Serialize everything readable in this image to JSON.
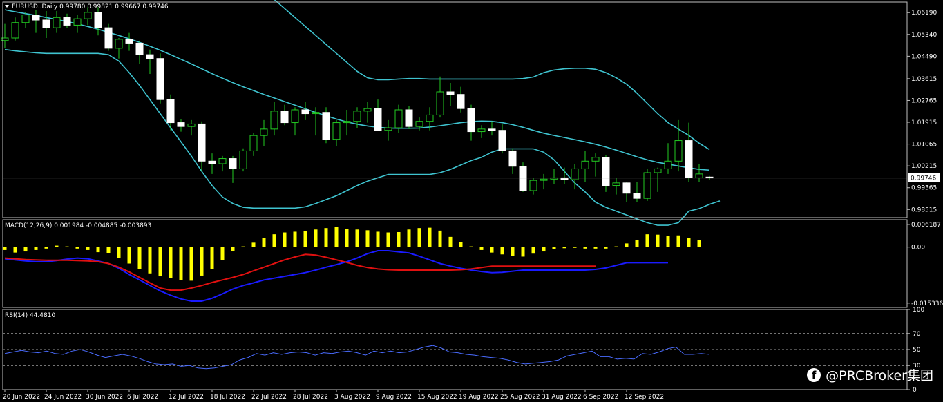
{
  "chart_data": [
    {
      "type": "candlestick",
      "title": "EURUSD..Daily  0.99780 0.99821 0.99667 0.99746",
      "symbol": "EURUSD..Daily",
      "ohlc_header": "0.99780 0.99821 0.99667 0.99746",
      "last_price": 0.99746,
      "last_price_label": "0.99746",
      "ylim": [
        0.982,
        1.066
      ],
      "yticks": [
        "1.06190",
        "1.05340",
        "1.04490",
        "1.03615",
        "1.02765",
        "1.01915",
        "1.01065",
        "1.00215",
        "0.99365",
        "0.98515"
      ],
      "yticks_values": [
        1.0619,
        1.0534,
        1.0449,
        1.03615,
        1.02765,
        1.01915,
        1.01065,
        1.00215,
        0.99365,
        0.98515
      ],
      "candles": [
        [
          1.051,
          1.0575,
          1.048,
          1.052
        ],
        [
          1.052,
          1.06,
          1.051,
          1.058
        ],
        [
          1.058,
          1.062,
          1.056,
          1.061
        ],
        [
          1.061,
          1.063,
          1.054,
          1.059
        ],
        [
          1.059,
          1.0625,
          1.052,
          1.056
        ],
        [
          1.056,
          1.0625,
          1.054,
          1.06
        ],
        [
          1.06,
          1.0615,
          1.056,
          1.057
        ],
        [
          1.057,
          1.061,
          1.054,
          1.0595
        ],
        [
          1.0595,
          1.064,
          1.057,
          1.062
        ],
        [
          1.062,
          1.064,
          1.053,
          1.056
        ],
        [
          1.056,
          1.0575,
          1.047,
          1.048
        ],
        [
          1.048,
          1.052,
          1.044,
          1.0515
        ],
        [
          1.0515,
          1.054,
          1.047,
          1.05
        ],
        [
          1.05,
          1.051,
          1.042,
          1.0455
        ],
        [
          1.0455,
          1.0475,
          1.038,
          1.044
        ],
        [
          1.044,
          1.046,
          1.0265,
          1.028
        ],
        [
          1.028,
          1.03,
          1.016,
          1.019
        ],
        [
          1.019,
          1.0205,
          1.0155,
          1.0175
        ],
        [
          1.0175,
          1.02,
          1.014,
          1.0185
        ],
        [
          1.0185,
          1.0195,
          1.0,
          1.004
        ],
        [
          1.004,
          1.007,
          0.999,
          1.003
        ],
        [
          1.003,
          1.006,
          1.0,
          1.005
        ],
        [
          1.005,
          1.006,
          0.9955,
          1.001
        ],
        [
          1.001,
          1.009,
          1.0,
          1.008
        ],
        [
          1.008,
          1.015,
          1.006,
          1.014
        ],
        [
          1.014,
          1.02,
          1.01,
          1.0165
        ],
        [
          1.0165,
          1.027,
          1.014,
          1.0235
        ],
        [
          1.0235,
          1.026,
          1.018,
          1.019
        ],
        [
          1.019,
          1.025,
          1.014,
          1.024
        ],
        [
          1.024,
          1.027,
          1.02,
          1.0225
        ],
        [
          1.0225,
          1.025,
          1.014,
          1.023
        ],
        [
          1.023,
          1.025,
          1.011,
          1.0125
        ],
        [
          1.0125,
          1.02,
          1.01,
          1.019
        ],
        [
          1.019,
          1.024,
          1.014,
          1.0195
        ],
        [
          1.0195,
          1.025,
          1.017,
          1.0235
        ],
        [
          1.0235,
          1.027,
          1.019,
          1.0245
        ],
        [
          1.0245,
          1.028,
          1.017,
          1.016
        ],
        [
          1.016,
          1.02,
          1.012,
          1.017
        ],
        [
          1.017,
          1.026,
          1.015,
          1.024
        ],
        [
          1.024,
          1.0255,
          1.0165,
          1.0175
        ],
        [
          1.0175,
          1.021,
          1.016,
          1.0195
        ],
        [
          1.0195,
          1.025,
          1.016,
          1.022
        ],
        [
          1.022,
          1.037,
          1.021,
          1.031
        ],
        [
          1.031,
          1.0345,
          1.0255,
          1.03
        ],
        [
          1.03,
          1.033,
          1.023,
          1.0245
        ],
        [
          1.0245,
          1.026,
          1.012,
          1.0155
        ],
        [
          1.0155,
          1.018,
          1.013,
          1.0165
        ],
        [
          1.0165,
          1.0195,
          1.014,
          1.016
        ],
        [
          1.016,
          1.0185,
          1.007,
          1.008
        ],
        [
          1.008,
          1.009,
          0.999,
          1.002
        ],
        [
          1.002,
          1.0035,
          0.992,
          0.9925
        ],
        [
          0.9925,
          0.9975,
          0.991,
          0.9965
        ],
        [
          0.9965,
          0.999,
          0.993,
          0.997
        ],
        [
          0.997,
          1.001,
          0.995,
          0.9975
        ],
        [
          0.9975,
          1.0015,
          0.995,
          0.9968
        ],
        [
          0.9968,
          1.003,
          0.993,
          1.001
        ],
        [
          1.001,
          1.008,
          0.996,
          1.004
        ],
        [
          1.004,
          1.007,
          0.998,
          1.0055
        ],
        [
          1.0055,
          1.0065,
          0.992,
          0.9945
        ],
        [
          0.9945,
          0.9975,
          0.991,
          0.9955
        ],
        [
          0.9955,
          0.996,
          0.988,
          0.9915
        ],
        [
          0.9915,
          0.996,
          0.988,
          0.9895
        ],
        [
          0.9895,
          1.001,
          0.9885,
          0.9995
        ],
        [
          0.9995,
          1.0015,
          0.992,
          1.001
        ],
        [
          1.001,
          1.011,
          0.999,
          1.004
        ],
        [
          1.004,
          1.02,
          1.0,
          1.012
        ],
        [
          1.012,
          1.019,
          0.996,
          0.9975
        ],
        [
          0.9975,
          1.003,
          0.996,
          0.999
        ],
        [
          0.9978,
          0.99821,
          0.99667,
          0.99746
        ]
      ],
      "bb_middle": [
        1.063,
        1.0622,
        1.0615,
        1.0608,
        1.06,
        1.0592,
        1.0584,
        1.0575,
        1.0565,
        1.0554,
        1.0542,
        1.053,
        1.0517,
        1.0503,
        1.0488,
        1.0472,
        1.0455,
        1.0437,
        1.0419,
        1.04,
        1.0381,
        1.0363,
        1.0346,
        1.033,
        1.0315,
        1.03,
        1.0286,
        1.0272,
        1.0258,
        1.0244,
        1.023,
        1.0217,
        1.0204,
        1.0193,
        1.0184,
        1.0177,
        1.0172,
        1.0169,
        1.0168,
        1.0168,
        1.0169,
        1.0173,
        1.0178,
        1.0184,
        1.019,
        1.0194,
        1.0196,
        1.0195,
        1.019,
        1.0182,
        1.0172,
        1.016,
        1.0149,
        1.014,
        1.0132,
        1.0124,
        1.0115,
        1.0106,
        1.0095,
        1.0083,
        1.007,
        1.0057,
        1.0045,
        1.0035,
        1.0028,
        1.0021,
        1.0014,
        1.0008,
        1.0005
      ],
      "bb_upper": [
        1.0745,
        1.0745,
        1.0745,
        1.0745,
        1.0745,
        1.0745,
        1.0745,
        1.0745,
        1.0745,
        1.0745,
        1.0745,
        1.0745,
        1.0745,
        1.0745,
        1.0745,
        1.0745,
        1.0745,
        1.0745,
        1.0745,
        1.0745,
        1.0745,
        1.0745,
        1.0745,
        1.0745,
        1.0725,
        1.07,
        1.067,
        1.0635,
        1.06,
        1.0565,
        1.053,
        1.0495,
        1.046,
        1.0425,
        1.039,
        1.0365,
        1.0357,
        1.0357,
        1.036,
        1.0362,
        1.0362,
        1.036,
        1.036,
        1.036,
        1.036,
        1.036,
        1.036,
        1.036,
        1.036,
        1.036,
        1.0362,
        1.0368,
        1.0385,
        1.0395,
        1.04,
        1.0402,
        1.0402,
        1.0398,
        1.0385,
        1.0365,
        1.034,
        1.0305,
        1.0265,
        1.0225,
        1.019,
        1.0165,
        1.014,
        1.011,
        1.0085
      ],
      "bb_lower": [
        1.0475,
        1.047,
        1.0466,
        1.0462,
        1.046,
        1.046,
        1.046,
        1.046,
        1.046,
        1.046,
        1.0455,
        1.043,
        1.0385,
        1.0335,
        1.028,
        1.0225,
        1.017,
        1.0115,
        1.006,
        1.0,
        0.9945,
        0.99,
        0.9875,
        0.986,
        0.9857,
        0.9857,
        0.9857,
        0.9857,
        0.9857,
        0.9862,
        0.9875,
        0.989,
        0.9905,
        0.9925,
        0.9945,
        0.9962,
        0.9975,
        0.9988,
        0.9988,
        0.9988,
        0.9988,
        0.9988,
        0.9995,
        1.0008,
        1.0025,
        1.0042,
        1.0055,
        1.0075,
        1.0088,
        1.0088,
        1.0088,
        1.0088,
        1.0075,
        1.0045,
        1.0,
        0.9955,
        0.992,
        0.988,
        0.986,
        0.9845,
        0.983,
        0.9815,
        0.98,
        0.979,
        0.979,
        0.98,
        0.9845,
        0.9855,
        0.9872,
        0.9885
      ],
      "xtick_labels": [
        "20 Jun 2022",
        "24 Jun 2022",
        "30 Jun 2022",
        "6 Jul 2022",
        "12 Jul 2022",
        "18 Jul 2022",
        "22 Jul 2022",
        "28 Jul 2022",
        "3 Aug 2022",
        "9 Aug 2022",
        "15 Aug 2022",
        "19 Aug 2022",
        "25 Aug 2022",
        "31 Aug 2022",
        "6 Sep 2022",
        "12 Sep 2022"
      ],
      "xtick_candle_index": [
        0,
        4,
        8,
        12,
        16,
        20,
        24,
        28,
        32,
        36,
        40,
        44,
        48,
        52,
        56,
        60
      ]
    },
    {
      "type": "bar+line",
      "title": "MACD(12,26,9) 0.001984 -0.004885 -0.003893",
      "ylim": [
        -0.0165,
        0.0075
      ],
      "yticks": [
        "0.006187",
        "0.00",
        "-0.015336"
      ],
      "yticks_values": [
        0.006187,
        0.0,
        -0.015336
      ],
      "histogram": [
        -0.0008,
        -0.0015,
        -0.0012,
        -0.0008,
        -0.0004,
        0.0004,
        0.0002,
        -0.0004,
        -0.0008,
        -0.0014,
        -0.0016,
        -0.003,
        -0.0045,
        -0.006,
        -0.0072,
        -0.008,
        -0.0085,
        -0.009,
        -0.0092,
        -0.0078,
        -0.006,
        -0.0035,
        -0.001,
        0.0002,
        0.0012,
        0.0025,
        0.0035,
        0.004,
        0.0042,
        0.0044,
        0.0048,
        0.0052,
        0.0055,
        0.005,
        0.0048,
        0.0046,
        0.0042,
        0.004,
        0.0041,
        0.0048,
        0.0052,
        0.0053,
        0.0045,
        0.0028,
        0.0013,
        0.0002,
        -0.0008,
        -0.0015,
        -0.002,
        -0.0025,
        -0.0026,
        -0.0018,
        -0.0012,
        -0.0006,
        -0.0003,
        -0.0002,
        -0.0004,
        -0.0004,
        -0.0004,
        0.0002,
        0.001,
        0.002,
        0.0035,
        0.0034,
        0.003,
        0.0032,
        0.0025,
        0.002
      ],
      "macd_line": [
        -0.0032,
        -0.0035,
        -0.0038,
        -0.004,
        -0.004,
        -0.0037,
        -0.0033,
        -0.003,
        -0.0032,
        -0.0038,
        -0.0045,
        -0.0058,
        -0.0075,
        -0.009,
        -0.0105,
        -0.012,
        -0.0132,
        -0.0142,
        -0.0148,
        -0.0148,
        -0.014,
        -0.0128,
        -0.0115,
        -0.0105,
        -0.0098,
        -0.009,
        -0.0085,
        -0.008,
        -0.0075,
        -0.007,
        -0.0063,
        -0.0055,
        -0.0048,
        -0.004,
        -0.003,
        -0.0018,
        -0.001,
        -0.001,
        -0.0013,
        -0.0016,
        -0.0025,
        -0.0035,
        -0.0045,
        -0.0052,
        -0.0058,
        -0.0063,
        -0.0067,
        -0.007,
        -0.0069,
        -0.0066,
        -0.0063,
        -0.0063,
        -0.0063,
        -0.0063,
        -0.0063,
        -0.0063,
        -0.0063,
        -0.0061,
        -0.0057,
        -0.005,
        -0.0043,
        -0.0043,
        -0.0043,
        -0.0043,
        -0.0043
      ],
      "signal_line": [
        -0.003,
        -0.0032,
        -0.0034,
        -0.0035,
        -0.0036,
        -0.0036,
        -0.0036,
        -0.0037,
        -0.0038,
        -0.004,
        -0.0045,
        -0.0055,
        -0.0068,
        -0.0083,
        -0.0098,
        -0.0112,
        -0.0118,
        -0.0118,
        -0.0112,
        -0.0105,
        -0.0097,
        -0.009,
        -0.0083,
        -0.0075,
        -0.0065,
        -0.0055,
        -0.0045,
        -0.0035,
        -0.0027,
        -0.002,
        -0.0022,
        -0.0028,
        -0.0035,
        -0.0042,
        -0.005,
        -0.0056,
        -0.006,
        -0.0062,
        -0.0063,
        -0.0063,
        -0.0063,
        -0.0063,
        -0.0063,
        -0.0063,
        -0.0062,
        -0.006,
        -0.0056,
        -0.0052,
        -0.0052,
        -0.0052,
        -0.0052,
        -0.0052,
        -0.0052,
        -0.0052,
        -0.0052,
        -0.0052,
        -0.0052,
        -0.0052
      ]
    },
    {
      "type": "line",
      "title": "RSI(14) 44.4810",
      "ylim": [
        0,
        100
      ],
      "yticks": [
        "100",
        "70",
        "50",
        "30",
        "0"
      ],
      "yticks_values": [
        100,
        70,
        50,
        30,
        0
      ],
      "dashed_levels": [
        70,
        50,
        30
      ],
      "values": [
        45,
        47,
        49,
        47,
        46,
        48,
        45,
        44,
        48,
        50,
        47,
        43,
        40,
        42,
        44,
        42,
        39,
        35,
        32,
        31,
        32,
        29,
        30,
        27,
        26,
        27,
        29,
        31,
        37,
        40,
        45,
        43,
        46,
        44,
        46,
        47,
        46,
        43,
        46,
        45,
        47,
        48,
        46,
        43,
        48,
        46,
        48,
        46,
        47,
        50,
        53,
        55,
        52,
        47,
        46,
        44,
        43,
        41,
        40,
        39,
        37,
        34,
        32,
        33,
        34,
        35,
        37,
        42,
        44,
        46,
        48,
        41,
        41,
        38,
        39,
        38,
        45,
        44,
        47,
        51,
        53,
        44,
        44,
        45,
        44
      ]
    }
  ],
  "watermark": {
    "text": "@PRCBroker集团",
    "icon": "facebook-icon",
    "icon_glyph": "f"
  }
}
